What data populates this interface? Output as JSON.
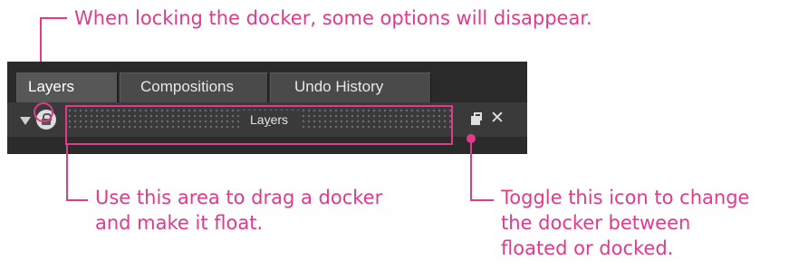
{
  "annotations": {
    "lock_note": "When locking the docker, some options will disappear.",
    "drag_note": [
      "Use this area to drag a docker",
      "and make it float."
    ],
    "toggle_note": [
      "Toggle this icon to change",
      "the docker between",
      "floated or docked."
    ]
  },
  "docker": {
    "tabs": [
      {
        "label": "Layers",
        "active": true
      },
      {
        "label": "Compositions",
        "active": false
      },
      {
        "label": "Undo History",
        "active": false
      }
    ],
    "title_bar": {
      "label_prefix": "La",
      "label_underlined": "y",
      "label_suffix": "ers",
      "icons": [
        "collapse-arrow-icon",
        "lock-icon",
        "float-toggle-icon",
        "close-icon"
      ]
    }
  },
  "colors": {
    "annotation": "#e03a8a",
    "docker_bg": "#2b2b2b",
    "tab_active": "#575757",
    "tab_inactive": "#4a4a4a"
  }
}
